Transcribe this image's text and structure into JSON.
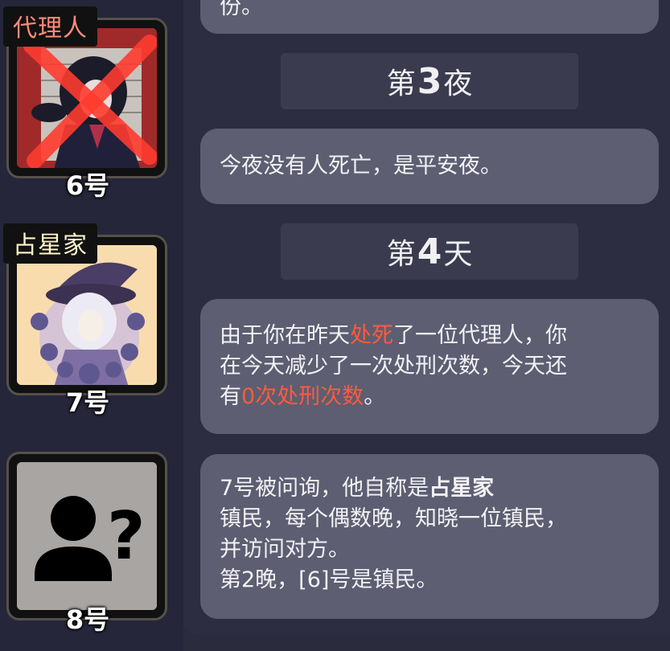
{
  "players": [
    {
      "role": "代理人",
      "number": "6号",
      "dead": true
    },
    {
      "role": "占星家",
      "number": "7号"
    },
    {
      "number": "8号"
    }
  ],
  "log": {
    "top_fragment": "份。",
    "night3": {
      "prefix": "第",
      "n": "3",
      "suffix": "夜"
    },
    "night3_msg": "今夜没有人死亡，是平安夜。",
    "day4": {
      "prefix": "第",
      "n": "4",
      "suffix": "天"
    },
    "day4_msg": {
      "a": "由于你在昨天",
      "b": "处死",
      "c": "了一位代理人，你",
      "d": "在今天减少了一次处刑次数，今天还",
      "e": "有",
      "f": "0次处刑次数",
      "g": "。"
    },
    "interrogate_msg": {
      "line1_a": "7号被问询，他自称是",
      "line1_b": "占星家",
      "line2": "镇民，每个偶数晚，知晓一位镇民，",
      "line3": "并访问对方。",
      "line4": "第2晚，[6]号是镇民。"
    }
  },
  "colors": {
    "highlight": "#ff5a3c",
    "bubble": "#5d5e72",
    "pill": "#3a3b4e"
  }
}
